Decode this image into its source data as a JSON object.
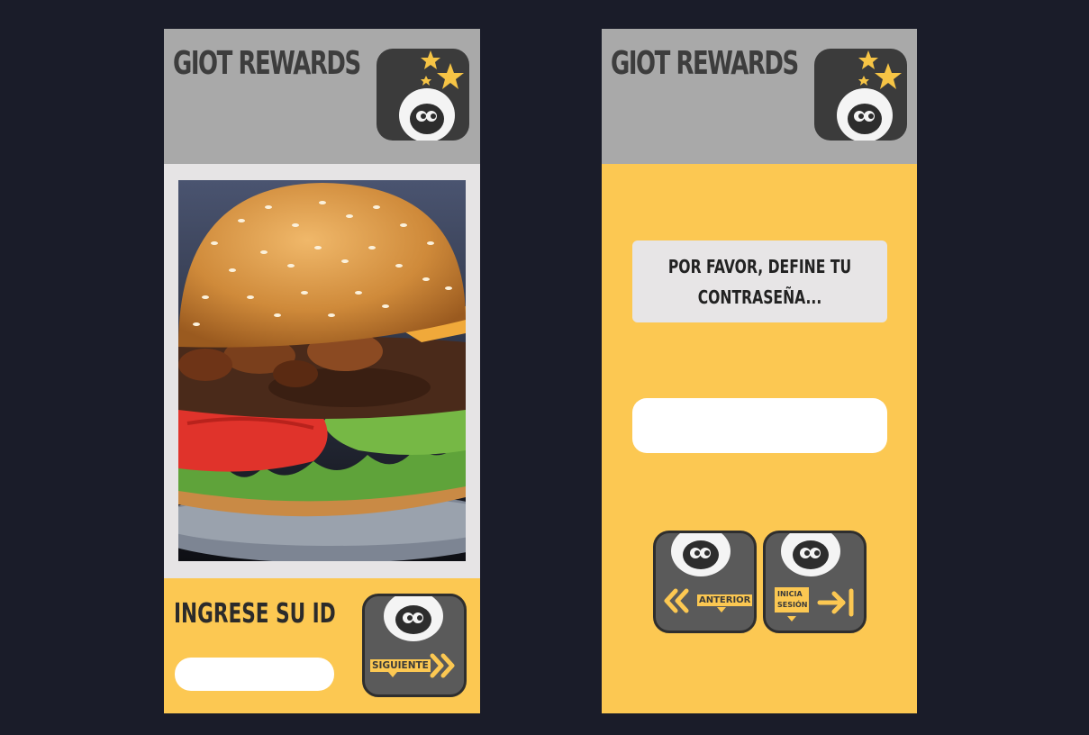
{
  "screen_1": {
    "brand": "GIOT REWARDS",
    "id_label": "INGRESE SU ID",
    "id_input_value": "",
    "next_button_label": "SIGUIENTE"
  },
  "screen_2": {
    "brand": "GIOT REWARDS",
    "prompt": "POR FAVOR, DEFINE TU CONTRASEÑA...",
    "password_input_value": "",
    "prev_button_label": "ANTERIOR",
    "login_button_label": "INICIA\nSESIÓN"
  },
  "colors": {
    "background": "#1a1c29",
    "header_gray": "#a9a9a9",
    "accent_yellow": "#fcc852",
    "tile_dark": "#3b3b3b",
    "star_yellow": "#f6c445"
  },
  "icons": [
    "stars-icon",
    "mascot-icon",
    "double-chevron-right-icon",
    "double-chevron-left-icon",
    "arrow-to-bar-icon"
  ]
}
